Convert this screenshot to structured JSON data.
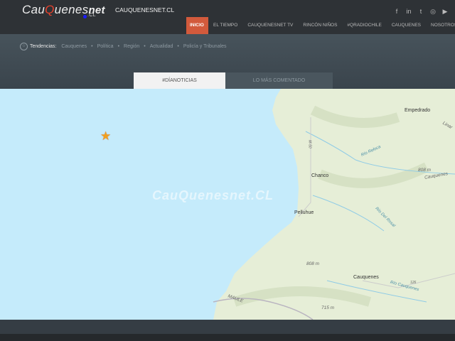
{
  "header": {
    "logo": {
      "a": "Cau",
      "q": "Q",
      "b": "uenes",
      "net": "net",
      "cl": ".CL"
    },
    "site_name": "CAUQUENESNET.CL",
    "social": [
      {
        "icon": "facebook-icon",
        "glyph": "f"
      },
      {
        "icon": "linkedin-icon",
        "glyph": "in"
      },
      {
        "icon": "twitter-icon",
        "glyph": "t"
      },
      {
        "icon": "instagram-icon",
        "glyph": "◎"
      },
      {
        "icon": "youtube-icon",
        "glyph": "▶"
      }
    ],
    "nav": [
      "INICIO",
      "EL TIEMPO",
      "CAUQUENESNET TV",
      "RINCÓN NIÑOS",
      "#QRADIOCHILE",
      "CAUQUENES",
      "NOSOTROS"
    ]
  },
  "trends": {
    "label": "Tendencias:",
    "items": [
      "Cauquenes",
      "Política",
      "Región",
      "Actualidad",
      "Policía y Tribunales"
    ]
  },
  "tabs": [
    "#DÍANOTICIAS",
    "LO MÁS COMENTADO"
  ],
  "map": {
    "watermark": "CauQuenesnet.CL",
    "places": [
      "Empedrado",
      "Chanco",
      "Pelluhue",
      "Cauquenes",
      "MAULE"
    ],
    "elevations": [
      "808 m",
      "808 m",
      "715 m"
    ],
    "rivers": [
      "Río Reloca",
      "Río Del Rosal",
      "Río Cauquenes",
      "Cauquenes"
    ],
    "roads": [
      "M-50",
      "126"
    ],
    "partial": "Linar"
  },
  "colors": {
    "accent": "#d25a3c",
    "ocean": "#c5ebfb",
    "land": "#e8efd9"
  }
}
